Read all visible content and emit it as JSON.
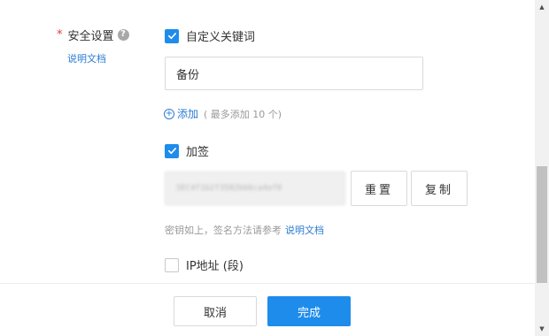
{
  "security": {
    "required_mark": "*",
    "label": "安全设置",
    "help_icon": "question-circle-icon",
    "doc_link": "说明文档"
  },
  "custom_keywords": {
    "checkbox_label": "自定义关键词",
    "checked": true,
    "input_value": "备份",
    "add_label": "添加",
    "add_icon": "plus-circle-icon",
    "add_hint": "( 最多添加 10 个)"
  },
  "signature": {
    "checkbox_label": "加签",
    "checked": true,
    "secret_value": "SEC4f1b2f3582bb6ca4ef8",
    "reset_label": "重置",
    "copy_label": "复制",
    "hint": "密钥如上，签名方法请参考",
    "hint_link": "说明文档"
  },
  "ip": {
    "checkbox_label": "IP地址 (段)",
    "checked": false
  },
  "footer": {
    "cancel_label": "取消",
    "done_label": "完成"
  },
  "colors": {
    "primary": "#1e8ceb",
    "link": "#2b7cd3",
    "required": "#e4393c"
  }
}
